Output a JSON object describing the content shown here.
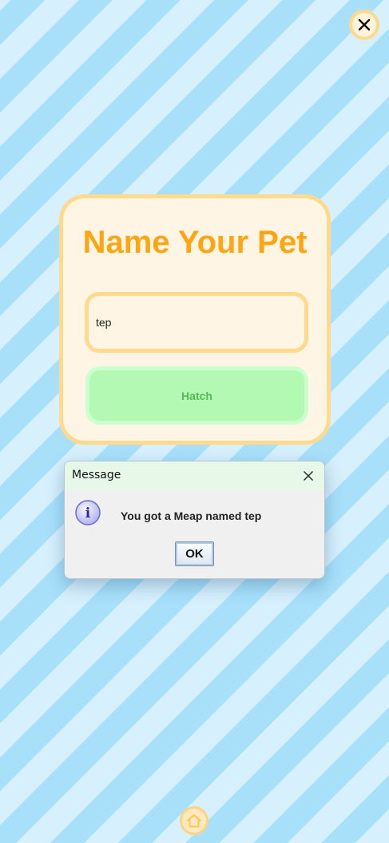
{
  "app": {
    "close_icon": "close-icon",
    "home_icon": "home-icon"
  },
  "card": {
    "title": "Name Your Pet",
    "name_input_value": "tep",
    "hatch_label": "Hatch"
  },
  "dialog": {
    "title": "Message",
    "message": "You got a Meap named tep",
    "ok_label": "OK",
    "info_icon_glyph": "i"
  },
  "colors": {
    "stripe_light": "#d6f0fd",
    "stripe_dark": "#a8e0fa",
    "title_orange": "#ffa512",
    "card_border": "#ffd98c",
    "card_bg": "#fff5e4",
    "hatch_green": "#b4f9b3",
    "hatch_text": "#55b955"
  }
}
